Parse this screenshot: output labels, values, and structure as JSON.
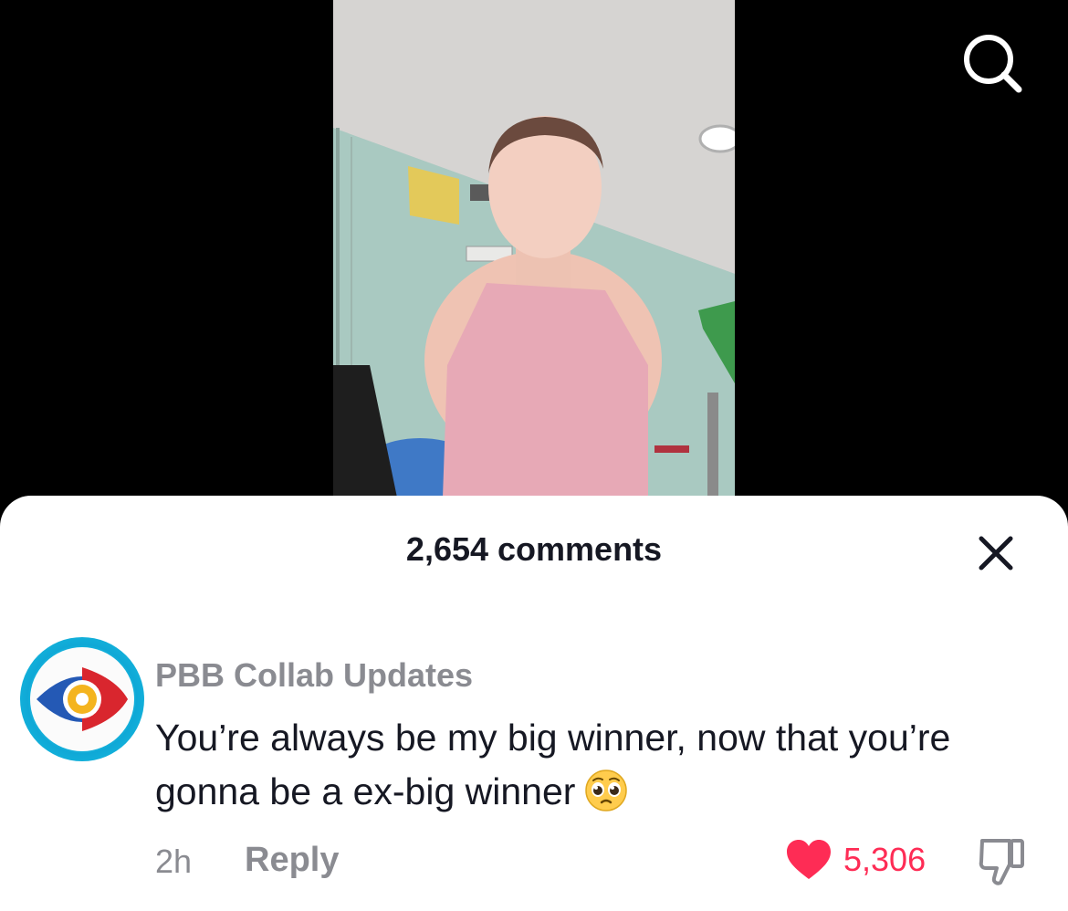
{
  "video": {
    "image_description": "selfie video of a person in a pink top"
  },
  "header": {
    "search_icon": "search-icon"
  },
  "comments_sheet": {
    "title": "2,654 comments",
    "close_icon": "close-icon",
    "comment": {
      "username": "PBB Collab Updates",
      "text": "You’re always be my big winner, now that you’re gonna be a ex-big winner",
      "emoji": "pleading-face-emoji",
      "time": "2h",
      "reply_label": "Reply",
      "like_count": "5,306",
      "like_color": "#fe2c55",
      "dislike_icon": "thumbs-down-icon"
    }
  }
}
